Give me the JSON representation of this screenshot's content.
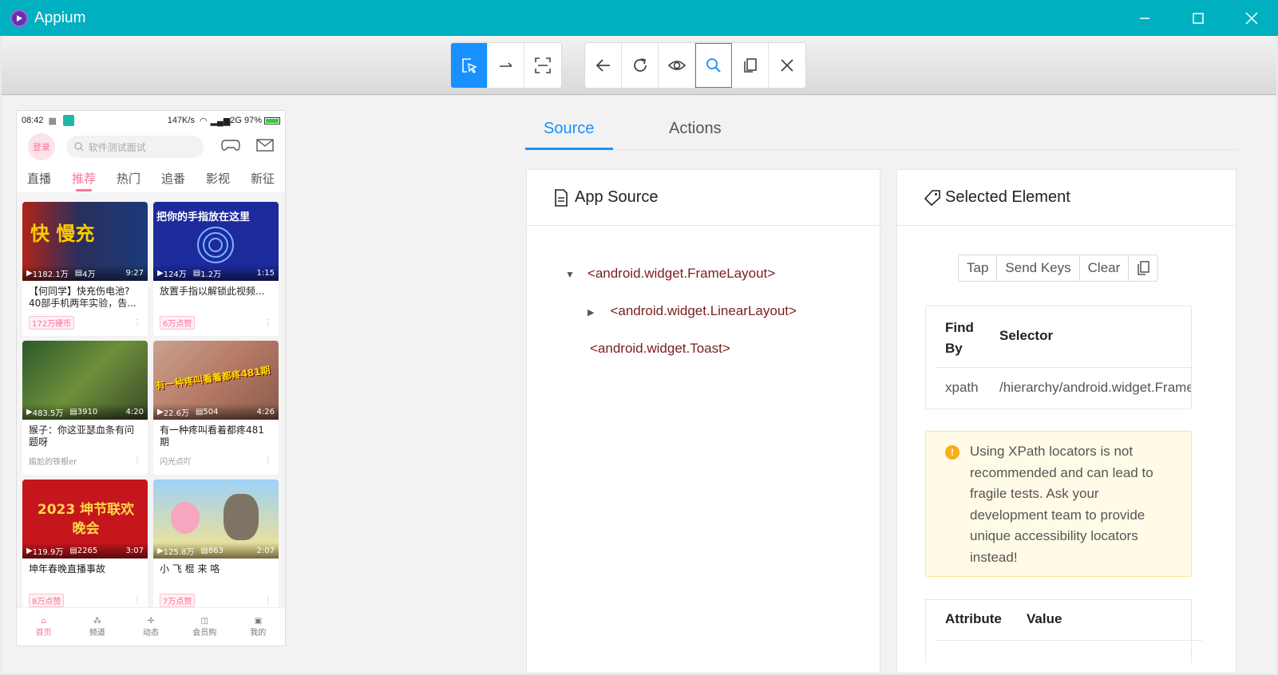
{
  "window": {
    "title": "Appium"
  },
  "toolbar": {
    "group1": [
      "select-elements-icon",
      "swipe-icon",
      "tap-coordinates-icon"
    ],
    "group2": [
      "back-icon",
      "refresh-icon",
      "show-hide-icon",
      "search-icon",
      "copy-xml-icon",
      "quit-session-icon"
    ]
  },
  "phone": {
    "status": {
      "time": "08:42",
      "speed": "147K/s",
      "network": "2G",
      "battery": "97%"
    },
    "login": "登录",
    "search_placeholder": "软件测试面试",
    "tabs": [
      "直播",
      "推荐",
      "热门",
      "追番",
      "影视",
      "新征"
    ],
    "active_tab": "推荐",
    "cards": [
      {
        "thumb_text": "快 慢充",
        "plays": "1182.1万",
        "danmaku": "4万",
        "duration": "9:27",
        "title": "【何同学】快充伤电池?40部手机两年实验，告...",
        "footer": "172万硬币",
        "footer_tag": true
      },
      {
        "thumb_text": "把你的手指放在这里",
        "plays": "124万",
        "danmaku": "1.2万",
        "duration": "1:15",
        "title": "放置手指以解锁此视频...",
        "footer": "6万点赞",
        "footer_tag": true
      },
      {
        "thumb_text": "",
        "plays": "483.5万",
        "danmaku": "3910",
        "duration": "4:20",
        "title": "猴子：你这亚瑟血条有问题呀",
        "footer": "尴尬的铁根er",
        "footer_tag": false
      },
      {
        "thumb_text": "有一种疼叫看着都疼481期",
        "plays": "22.6万",
        "danmaku": "504",
        "duration": "4:26",
        "title": "有一种疼叫看着都疼481期",
        "footer": "闪光点吖",
        "footer_tag": false
      },
      {
        "thumb_text": "2023 坤节联欢晚会",
        "plays": "119.9万",
        "danmaku": "2265",
        "duration": "3:07",
        "title": "坤年春晚直播事故",
        "footer": "8万点赞",
        "footer_tag": true
      },
      {
        "thumb_text": "",
        "plays": "125.8万",
        "danmaku": "863",
        "duration": "2:07",
        "title": "小 飞 棍 来 咯",
        "footer": "7万点赞",
        "footer_tag": true
      }
    ],
    "bottom_nav": [
      "首页",
      "频道",
      "动态",
      "会员购",
      "我的"
    ]
  },
  "tabs": {
    "source": "Source",
    "actions": "Actions"
  },
  "app_source": {
    "title": "App Source",
    "nodes": [
      "<android.widget.FrameLayout>",
      "<android.widget.LinearLayout>",
      "<android.widget.Toast>"
    ]
  },
  "selected": {
    "title": "Selected Element",
    "buttons": {
      "tap": "Tap",
      "send_keys": "Send Keys",
      "clear": "Clear"
    },
    "find_by_header": "Find By",
    "selector_header": "Selector",
    "find_by": "xpath",
    "selector": "/hierarchy/android.widget.FrameLayout",
    "warning": "Using XPath locators is not recommended and can lead to fragile tests. Ask your development team to provide unique accessibility locators instead!",
    "attr_header": "Attribute",
    "value_header": "Value"
  }
}
